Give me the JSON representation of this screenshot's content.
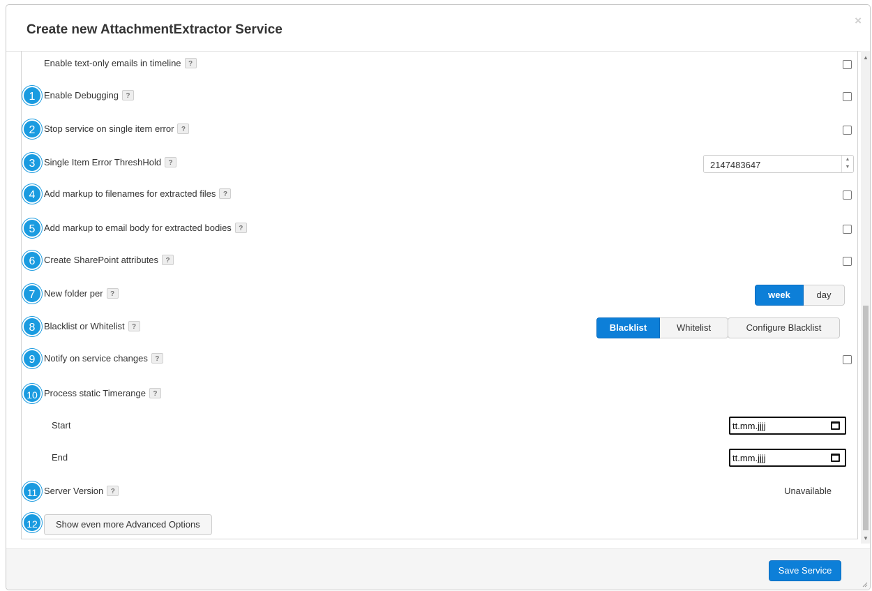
{
  "dialog": {
    "title": "Create new AttachmentExtractor Service",
    "close_symbol": "×"
  },
  "help_symbol": "?",
  "rows": {
    "text_only_emails": {
      "label": "Enable text-only emails in timeline",
      "checked": false
    },
    "debugging": {
      "badge": "1",
      "label": "Enable Debugging",
      "checked": false
    },
    "stop_on_error": {
      "badge": "2",
      "label": "Stop service on single item error",
      "checked": false
    },
    "error_threshold": {
      "badge": "3",
      "label": "Single Item Error ThreshHold",
      "value": "2147483647"
    },
    "markup_filenames": {
      "badge": "4",
      "label": "Add markup to filenames for extracted files",
      "checked": false
    },
    "markup_body": {
      "badge": "5",
      "label": "Add markup to email body for extracted bodies",
      "checked": false
    },
    "sharepoint_attributes": {
      "badge": "6",
      "label": "Create SharePoint attributes",
      "checked": false
    },
    "new_folder_per": {
      "badge": "7",
      "label": "New folder per",
      "options": [
        "week",
        "day"
      ],
      "selected": "week"
    },
    "list_mode": {
      "badge": "8",
      "label": "Blacklist or Whitelist",
      "options": [
        "Blacklist",
        "Whitelist"
      ],
      "selected": "Blacklist",
      "configure_label": "Configure Blacklist"
    },
    "notify_changes": {
      "badge": "9",
      "label": "Notify on service changes",
      "checked": false
    },
    "static_timerange": {
      "badge": "10",
      "label": "Process static Timerange"
    },
    "start": {
      "label": "Start",
      "placeholder": "tt.mm.jjjj"
    },
    "end": {
      "label": "End",
      "placeholder": "tt.mm.jjjj"
    },
    "server_version": {
      "badge": "11",
      "label": "Server Version",
      "value": "Unavailable"
    },
    "more_options": {
      "badge": "12",
      "label": "Show even more Advanced Options"
    }
  },
  "footer": {
    "save_label": "Save Service"
  },
  "colors": {
    "accent": "#0d7fd8",
    "badge": "#1a9be0"
  },
  "icons": [
    "close-icon",
    "help-icon",
    "calendar-icon",
    "scroll-up-arrow-icon",
    "scroll-down-arrow-icon",
    "spinner-up-icon",
    "spinner-down-icon",
    "resize-grip-icon"
  ]
}
